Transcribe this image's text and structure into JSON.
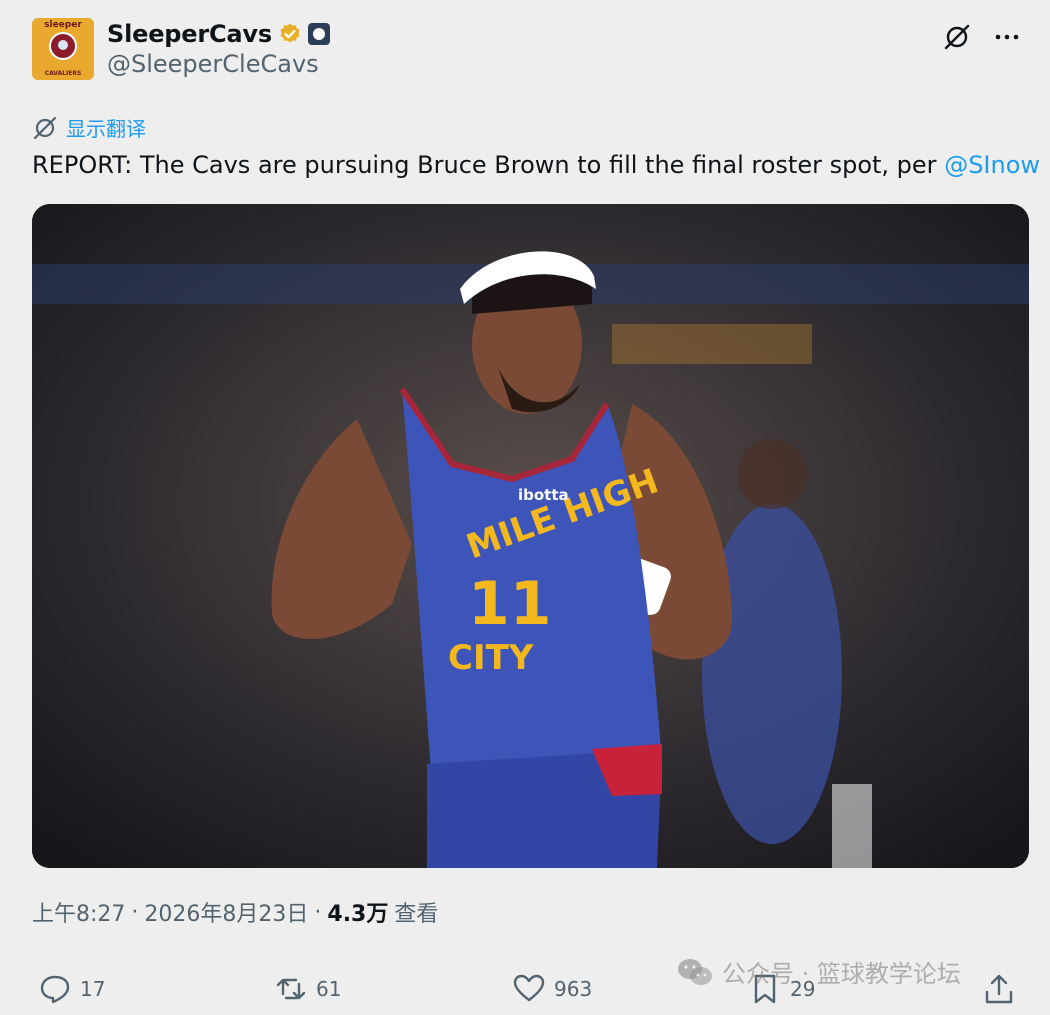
{
  "author": {
    "display_name": "SleeperCavs",
    "handle": "@SleeperCleCavs",
    "avatar_top_text": "sleeper",
    "avatar_bottom_text": "CAVALIERS"
  },
  "translate_label": "显示翻译",
  "tweet": {
    "text": "REPORT: The Cavs are pursuing Bruce Brown to fill the final roster spot, per ",
    "mention": "@SInow"
  },
  "media": {
    "jersey_text_top": "MILE HIGH",
    "jersey_number": "11",
    "jersey_text_bottom": "CITY",
    "sponsor": "ibotta"
  },
  "meta": {
    "time": "上午8:27",
    "sep1": "·",
    "date": "2026年8月23日",
    "sep2": "·",
    "views": "4.3万",
    "views_label": "查看"
  },
  "actions": {
    "replies": "17",
    "reposts": "61",
    "likes": "963",
    "bookmarks": "29"
  },
  "watermark": "公众号 · 篮球教学论坛",
  "colors": {
    "link": "#1d9bf0",
    "muted": "#536471",
    "verified": "#e8b028"
  }
}
